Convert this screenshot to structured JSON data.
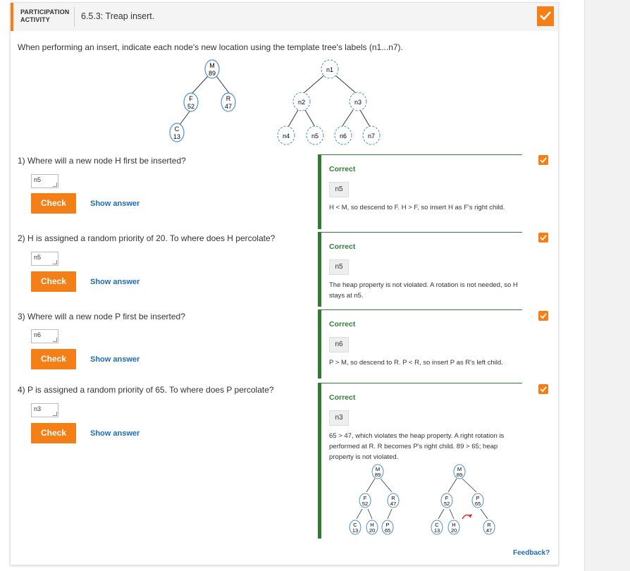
{
  "header": {
    "pa_label_line1": "PARTICIPATION",
    "pa_label_line2": "ACTIVITY",
    "title": "6.5.3: Treap insert."
  },
  "instructions": "When performing an insert, indicate each node's new location using the template tree's labels (n1...n7).",
  "tree_example": {
    "nodes": [
      {
        "letter": "M",
        "priority": "89"
      },
      {
        "letter": "F",
        "priority": "52"
      },
      {
        "letter": "R",
        "priority": "47"
      },
      {
        "letter": "C",
        "priority": "13"
      }
    ]
  },
  "template_tree": {
    "labels": [
      "n1",
      "n2",
      "n3",
      "n4",
      "n5",
      "n6",
      "n7"
    ]
  },
  "questions": [
    {
      "number": "1)",
      "text": "Where will a new node H first be inserted?",
      "answer": "n5",
      "check_label": "Check",
      "show_answer_label": "Show answer",
      "feedback": {
        "status": "Correct",
        "answer": "n5",
        "explanation": "H < M, so descend to F. H > F, so insert H as F's right child."
      }
    },
    {
      "number": "2)",
      "text": "H is assigned a random priority of 20. To where does H percolate?",
      "answer": "n5",
      "check_label": "Check",
      "show_answer_label": "Show answer",
      "feedback": {
        "status": "Correct",
        "answer": "n5",
        "explanation": "The heap property is not violated. A rotation is not needed, so H stays at n5."
      }
    },
    {
      "number": "3)",
      "text": "Where will a new node P first be inserted?",
      "answer": "n6",
      "check_label": "Check",
      "show_answer_label": "Show answer",
      "feedback": {
        "status": "Correct",
        "answer": "n6",
        "explanation": "P > M, so descend to R. P < R, so insert P as R's left child."
      }
    },
    {
      "number": "4)",
      "text": "P is assigned a random priority of 65. To where does P percolate?",
      "answer": "n3",
      "check_label": "Check",
      "show_answer_label": "Show answer",
      "feedback": {
        "status": "Correct",
        "answer": "n3",
        "explanation": "65 > 47, which violates the heap property. A right rotation is performed at R. R becomes P's right child. 89 > 65; heap property is not violated."
      }
    }
  ],
  "feedback_trees": {
    "before": [
      {
        "letter": "M",
        "priority": "89"
      },
      {
        "letter": "F",
        "priority": "52"
      },
      {
        "letter": "R",
        "priority": "47"
      },
      {
        "letter": "C",
        "priority": "13"
      },
      {
        "letter": "H",
        "priority": "20"
      },
      {
        "letter": "P",
        "priority": "65"
      }
    ],
    "after": [
      {
        "letter": "M",
        "priority": "89"
      },
      {
        "letter": "F",
        "priority": "52"
      },
      {
        "letter": "P",
        "priority": "65"
      },
      {
        "letter": "C",
        "priority": "13"
      },
      {
        "letter": "H",
        "priority": "20"
      },
      {
        "letter": "R",
        "priority": "47"
      }
    ]
  },
  "feedback_link": "Feedback?",
  "colors": {
    "accent": "#f57f17",
    "correct": "#2e7d32",
    "link": "#1e6bb8",
    "node_border": "#4a8fd6",
    "rotation_arrow": "#d32f2f"
  }
}
